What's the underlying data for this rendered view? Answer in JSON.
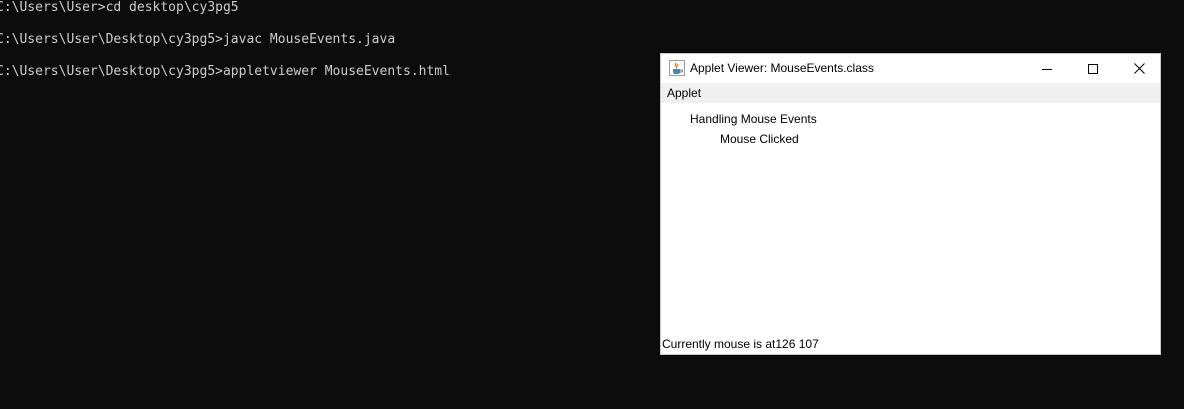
{
  "console": {
    "lines": [
      "C:\\Users\\User>cd desktop\\cy3pg5",
      "C:\\Users\\User\\Desktop\\cy3pg5>javac MouseEvents.java",
      "C:\\Users\\User\\Desktop\\cy3pg5>appletviewer MouseEvents.html"
    ]
  },
  "window": {
    "title": "Applet Viewer: MouseEvents.class",
    "menu": [
      "Applet"
    ],
    "content": {
      "heading": "Handling Mouse Events",
      "event": "Mouse Clicked"
    },
    "status": "Currently mouse is at126 107"
  },
  "icons": {
    "app": "java-coffee-icon",
    "minimize": "minimize-icon",
    "maximize": "maximize-icon",
    "close": "close-icon"
  },
  "colors": {
    "console_bg": "#0c0c0c",
    "console_text": "#cccccc",
    "menubar_bg": "#f0f0f0"
  }
}
